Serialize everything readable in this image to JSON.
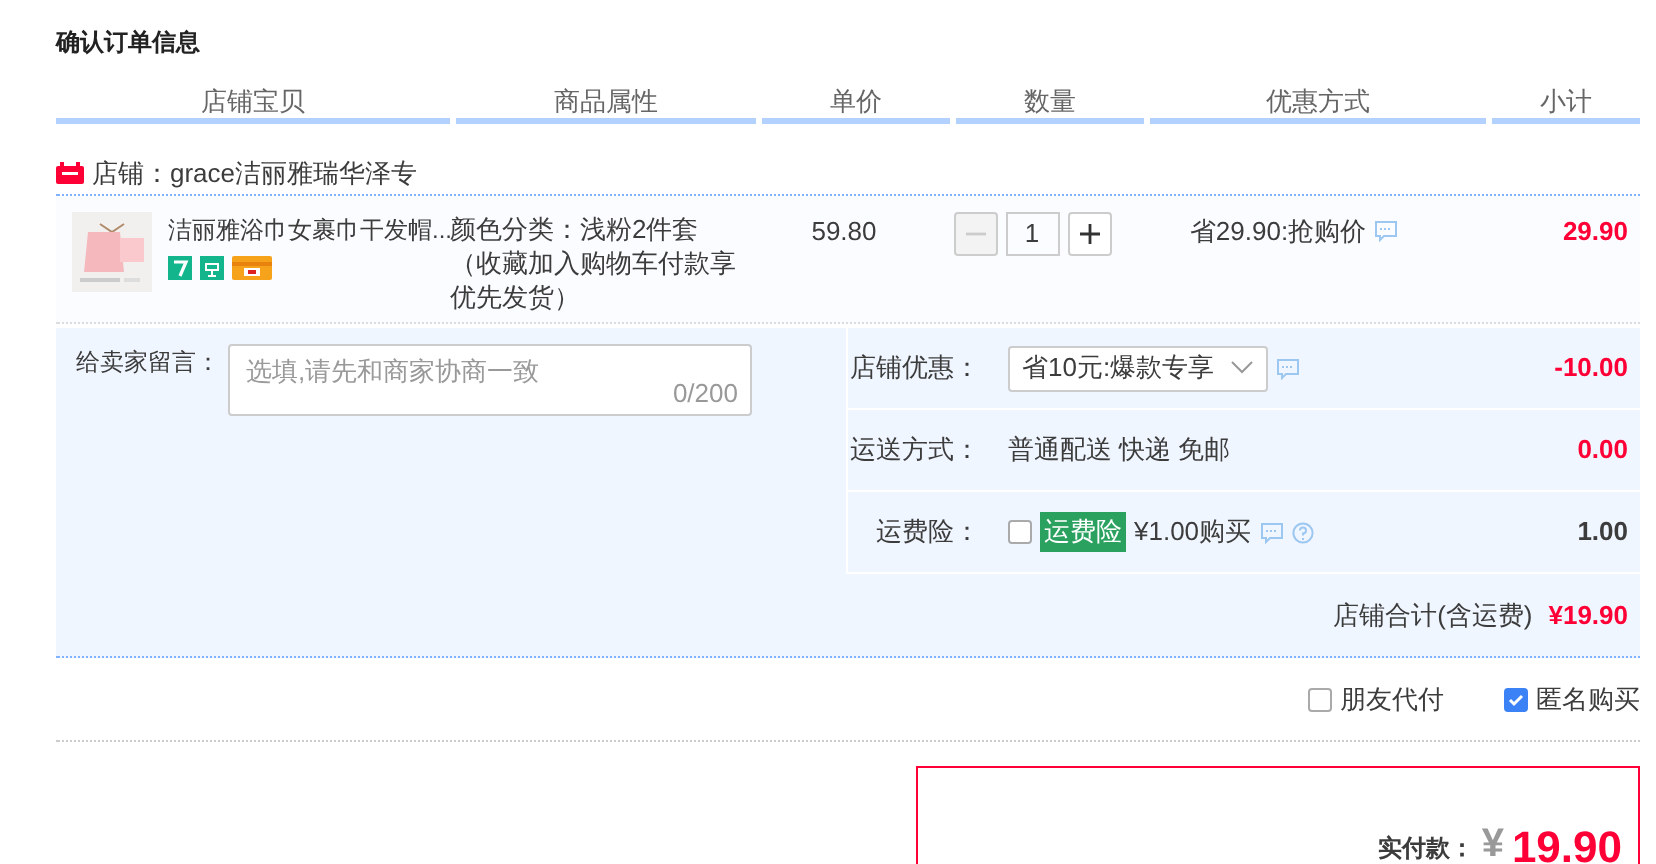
{
  "page_title": "确认订单信息",
  "columns": [
    "店铺宝贝",
    "商品属性",
    "单价",
    "数量",
    "优惠方式",
    "小计"
  ],
  "store": {
    "label": "店铺：grace洁丽雅瑞华泽专"
  },
  "item": {
    "name": "洁丽雅浴巾女裹巾干发帽...",
    "attributes": "颜色分类：浅粉2件套（收藏加入购物车付款享优先发货）",
    "price": "59.80",
    "quantity": "1",
    "decrease_disabled": true,
    "promotion": "省29.90:抢购价",
    "subtotal": "29.90"
  },
  "message": {
    "label": "给卖家留言：",
    "placeholder": "选填,请先和商家协商一致",
    "counter": "0/200"
  },
  "store_discount": {
    "label": "店铺优惠：",
    "value": "省10元:爆款专享",
    "amount": "-10.00"
  },
  "shipping": {
    "label": "运送方式：",
    "value": "普通配送 快递 免邮",
    "amount": "0.00"
  },
  "insurance": {
    "label": "运费险：",
    "checked": false,
    "tag": "运费险",
    "text": "¥1.00购买",
    "amount": "1.00"
  },
  "store_total": {
    "label": "店铺合计(含运费)",
    "amount": "¥19.90"
  },
  "options": [
    {
      "label": "朋友代付",
      "checked": false
    },
    {
      "label": "匿名购买",
      "checked": true
    }
  ],
  "payment": {
    "label": "实付款：",
    "currency": "¥",
    "amount": "19.90"
  }
}
